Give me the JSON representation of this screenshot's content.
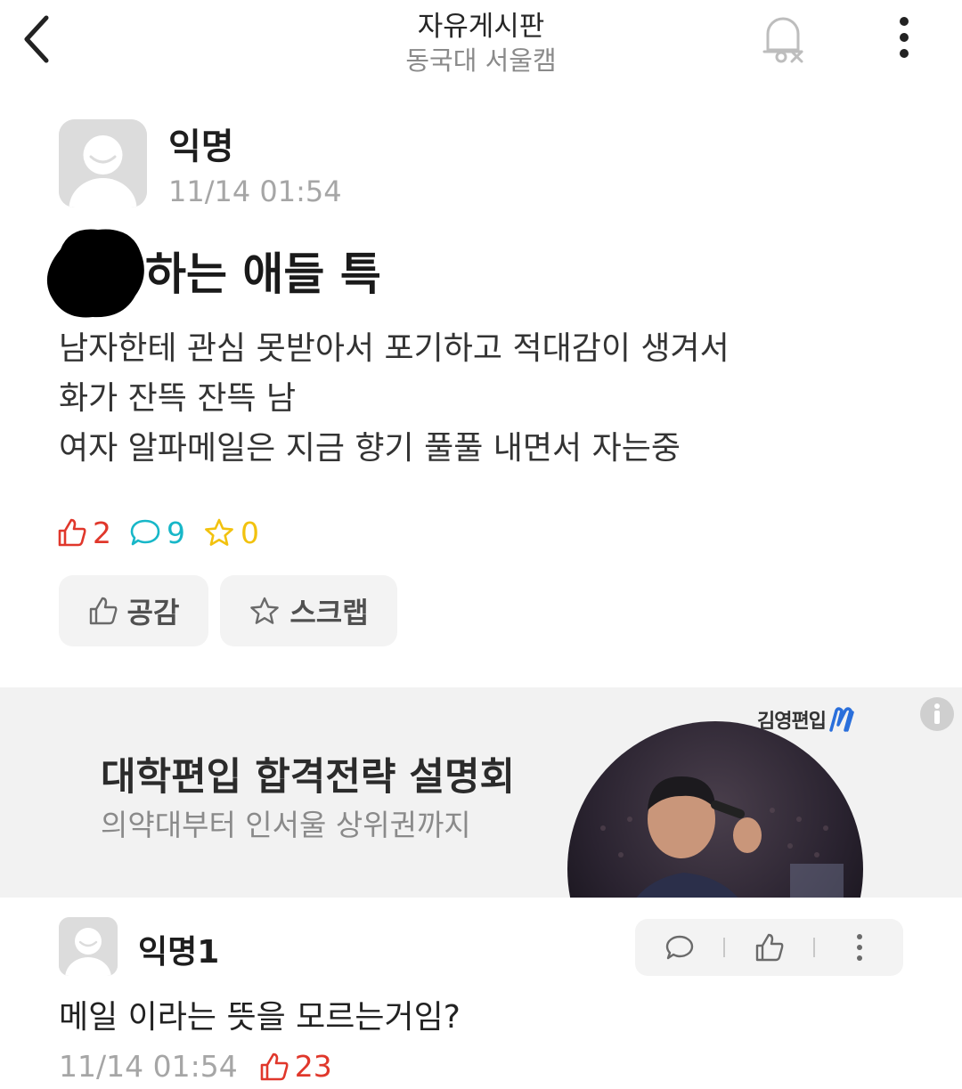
{
  "header": {
    "title": "자유게시판",
    "subtitle": "동국대 서울캠",
    "back_icon": "chevron-left-icon",
    "notification_icon": "bell-off-icon",
    "more_icon": "more-vertical-icon"
  },
  "post": {
    "author": "익명",
    "time": "11/14 01:54",
    "title": "하는 애들 특",
    "body_lines": [
      "남자한테 관심 못받아서 포기하고 적대감이 생겨서",
      "화가 잔뜩 잔뜩 남",
      "여자 알파메일은 지금 향기 풀풀 내면서 자는중"
    ],
    "stats": {
      "likes": "2",
      "comments": "9",
      "scraps": "0"
    },
    "buttons": {
      "like_label": "공감",
      "scrap_label": "스크랩"
    }
  },
  "ad": {
    "title": "대학편입 합격전략 설명회",
    "subtitle": "의약대부터 인서울 상위권까지",
    "brand": "김영편입"
  },
  "comment": {
    "author": "익명1",
    "body": "메일 이라는 뜻을 모르는거임?",
    "time": "11/14 01:54",
    "likes": "23"
  },
  "colors": {
    "like": "#e0372b",
    "comment": "#17b7c8",
    "scrap": "#f2c20e",
    "muted": "#a6a6a6"
  }
}
